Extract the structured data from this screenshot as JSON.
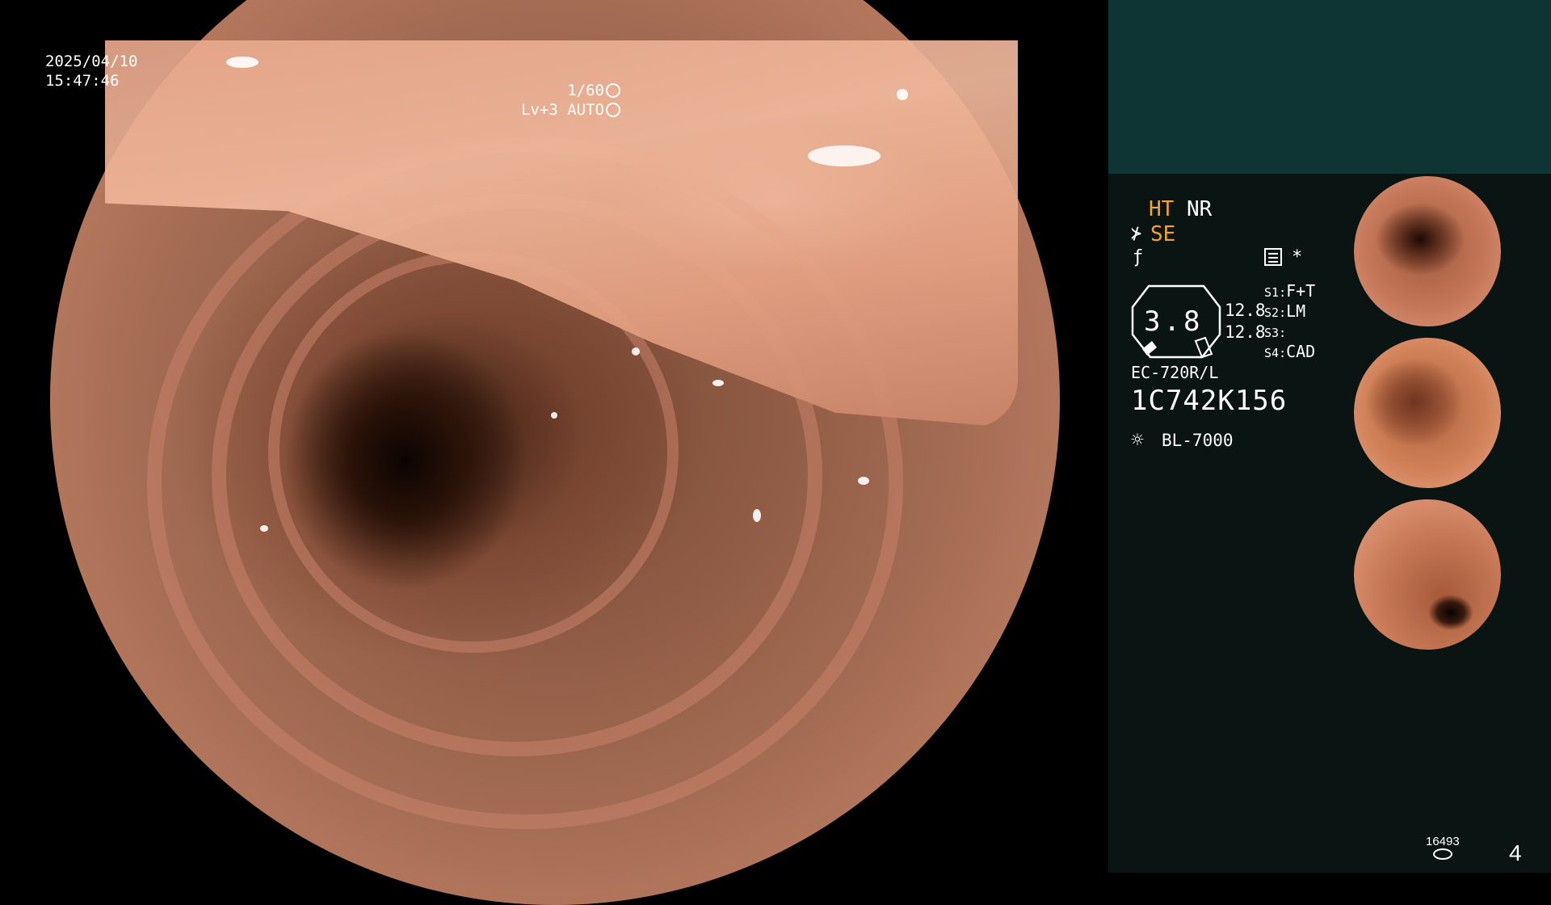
{
  "view": {
    "date": "2025/04/10",
    "time": "15:47:46",
    "shutter": "1/60",
    "level": "Lv+3",
    "mode": "AUTO"
  },
  "panel": {
    "ht": "HT",
    "nr": "NR",
    "se": "SE",
    "se_icon": "scissor-like-icon",
    "f_icon": "f-slash-icon",
    "menu_icon": "settings-list-icon",
    "star": "*",
    "dial_value": "3.8",
    "value_a": "12.8",
    "value_b": "12.8",
    "switches": [
      {
        "key": "S1",
        "value": "F+T"
      },
      {
        "key": "S2",
        "value": "LM"
      },
      {
        "key": "S3",
        "value": ""
      },
      {
        "key": "S4",
        "value": "CAD"
      }
    ],
    "scope_model": "EC-720R/L",
    "serial": "1C742K156",
    "light_icon": "sun-icon",
    "light_source": "BL-7000",
    "count": "16493",
    "page": "4"
  },
  "colors": {
    "panel_bg": "#0a1413",
    "panel_top": "#0e3533",
    "accent_orange": "#f3a431"
  }
}
